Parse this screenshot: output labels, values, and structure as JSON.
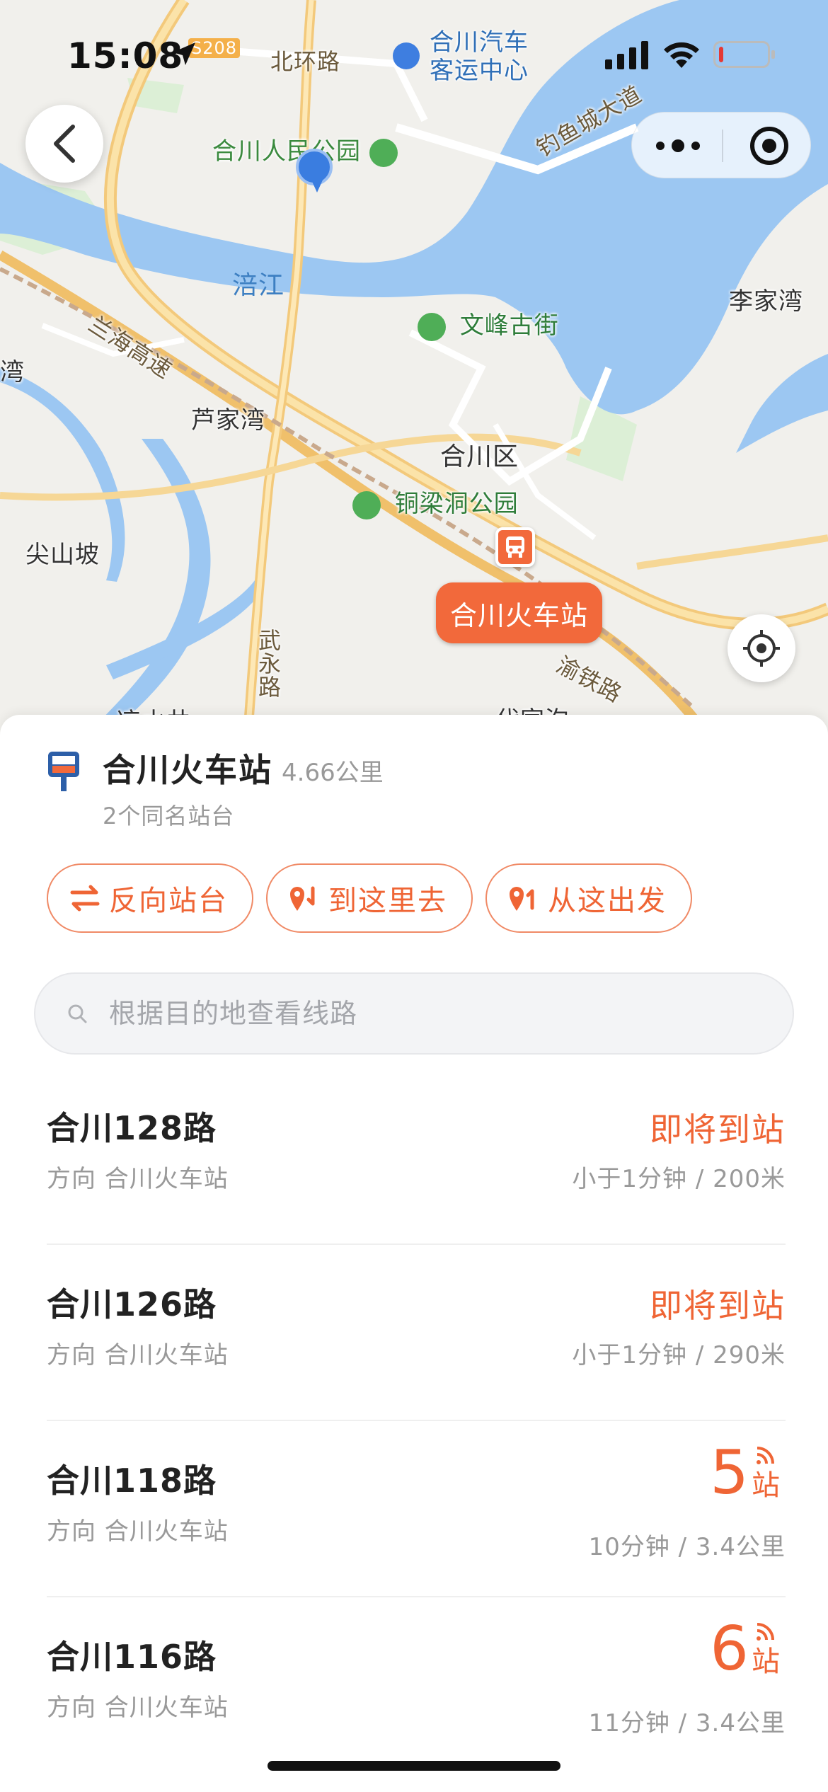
{
  "status_bar": {
    "time": "15:08"
  },
  "map": {
    "labels": {
      "road_s208": "S208",
      "beihuan_road": "北环路",
      "bus_terminal_line1": "合川汽车",
      "bus_terminal_line2": "客运中心",
      "people_park": "合川人民公园",
      "diaoyu_avenue": "钓鱼城大道",
      "fu_river": "涪江",
      "li_jia_wan": "李家湾",
      "wenfeng_street": "文峰古街",
      "lanhai_expressway": "兰海高速",
      "wan_fragment": "湾",
      "lu_jia_wan": "芦家湾",
      "hechuan_district": "合川区",
      "tongliangdong_park": "铜梁洞公园",
      "jian_shan_po": "尖山坡",
      "wuyong_road": "武永路",
      "yu_railway": "渝铁路",
      "liangshuijing_partial": "凉水井",
      "fujiagou_partial": "代家沟",
      "station_tag": "合川火车站"
    }
  },
  "station": {
    "name": "合川火车站",
    "distance": "4.66公里",
    "subtitle": "2个同名站台"
  },
  "actions": {
    "reverse": "反向站台",
    "go_here": "到这里去",
    "start_here": "从这出发"
  },
  "search": {
    "placeholder": "根据目的地查看线路"
  },
  "routes": [
    {
      "name": "合川128路",
      "direction": "方向 合川火车站",
      "status": "即将到站",
      "eta": "小于1分钟 / 200米"
    },
    {
      "name": "合川126路",
      "direction": "方向 合川火车站",
      "status": "即将到站",
      "eta": "小于1分钟 / 290米"
    },
    {
      "name": "合川118路",
      "direction": "方向 合川火车站",
      "stops": "5",
      "stops_unit": "站",
      "eta": "10分钟 / 3.4公里"
    },
    {
      "name": "合川116路",
      "direction": "方向 合川火车站",
      "stops": "6",
      "stops_unit": "站",
      "eta": "11分钟 / 3.4公里"
    }
  ],
  "colors": {
    "accent": "#ef6535",
    "river": "#9cc7f2",
    "user_location": "#3a7de0"
  },
  "icons": {
    "back": "chevron-left-icon",
    "more": "more-dots-icon",
    "target": "target-icon",
    "locate": "locate-icon",
    "station": "bus-stop-sign-icon",
    "search": "search-icon",
    "realtime": "realtime-signal-icon"
  }
}
